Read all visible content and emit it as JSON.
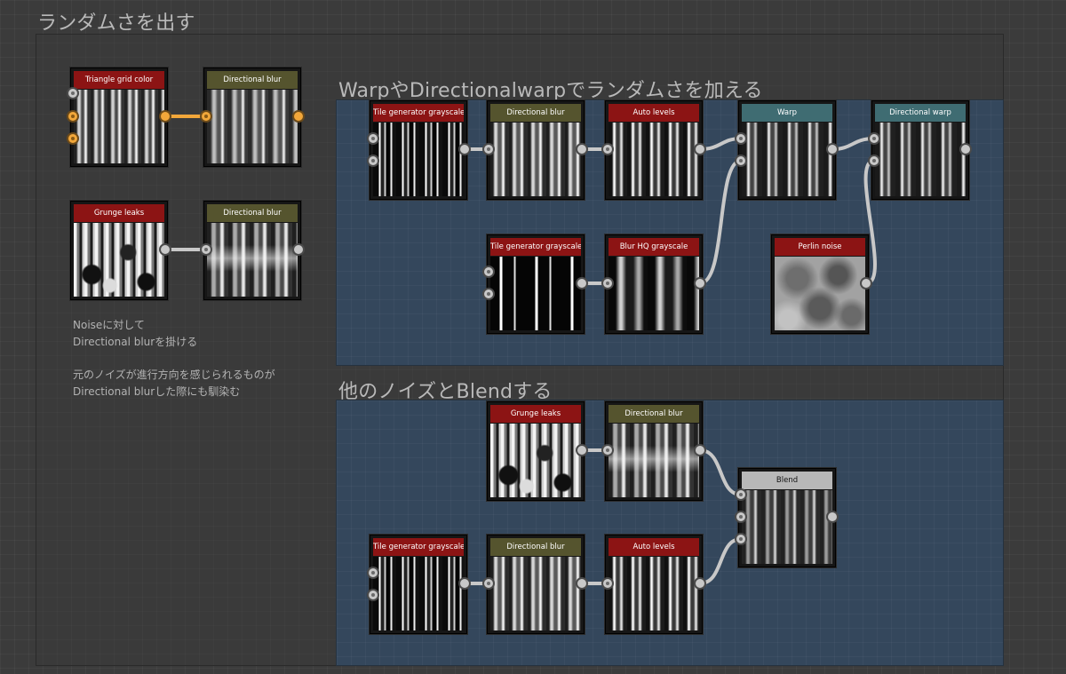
{
  "frames": {
    "outer_title": "ランダムさを出す",
    "warp_title": "WarpやDirectionalwarpでランダムさを加える",
    "blend_title": "他のノイズとBlendする"
  },
  "nodes": {
    "triangle_grid_color": "Triangle grid color",
    "directional_blur_1": "Directional blur",
    "grunge_leaks_1": "Grunge leaks",
    "directional_blur_2": "Directional blur",
    "tile_gen_1": "Tile generator grayscale",
    "directional_blur_3": "Directional blur",
    "auto_levels_1": "Auto levels",
    "warp": "Warp",
    "directional_warp": "Directional warp",
    "tile_gen_2": "Tile generator grayscale",
    "blur_hq": "Blur HQ grayscale",
    "perlin_noise": "Perlin noise",
    "grunge_leaks_2": "Grunge leaks",
    "directional_blur_4": "Directional blur",
    "blend": "Blend",
    "tile_gen_3": "Tile generator grayscale",
    "directional_blur_5": "Directional blur",
    "auto_levels_2": "Auto levels"
  },
  "notes": {
    "line1": "Noiseに対して",
    "line2": "Directional blurを掛ける",
    "line3": "元のノイズが進行方向を感じられるものが",
    "line4": "Directional blurした際にも馴染む"
  },
  "colors": {
    "header_red": "#8c1414",
    "header_olive": "#55542e",
    "header_teal": "#3f6c72",
    "header_gray": "#b8b8b8",
    "frame_blue": "#34475c",
    "wire_orange": "#f2a73a",
    "wire_gray": "#c8c8c8"
  }
}
